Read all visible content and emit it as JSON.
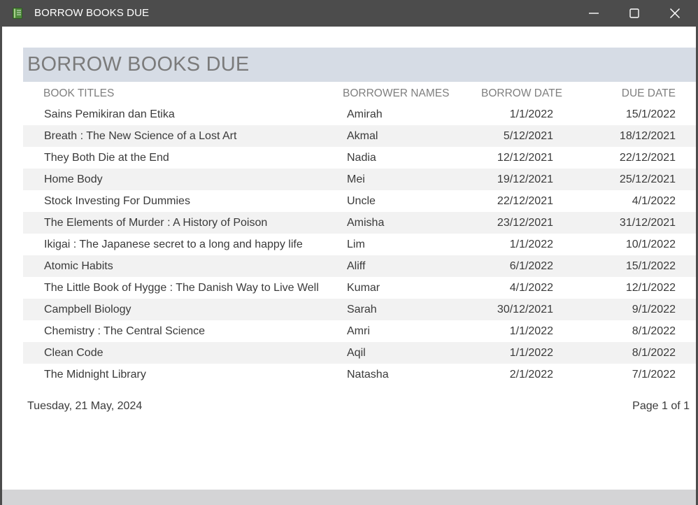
{
  "window": {
    "title": "BORROW BOOKS DUE",
    "app_icon": "book-icon",
    "controls": {
      "minimize_icon": "minimize-icon",
      "maximize_icon": "maximize-icon",
      "close_icon": "close-icon"
    }
  },
  "report": {
    "title": "BORROW BOOKS DUE",
    "header_color": "#d6dce5",
    "alt_row_color": "#f2f2f2",
    "columns": {
      "title": "BOOK TITLES",
      "borrower": "BORROWER NAMES",
      "borrow_date": "BORROW DATE",
      "due_date": "DUE DATE"
    },
    "rows": [
      {
        "title": "Sains Pemikiran dan Etika",
        "borrower": "Amirah",
        "borrow_date": "1/1/2022",
        "due_date": "15/1/2022"
      },
      {
        "title": "Breath : The New Science of a Lost Art",
        "borrower": "Akmal",
        "borrow_date": "5/12/2021",
        "due_date": "18/12/2021"
      },
      {
        "title": "They Both Die at the End",
        "borrower": "Nadia",
        "borrow_date": "12/12/2021",
        "due_date": "22/12/2021"
      },
      {
        "title": "Home Body",
        "borrower": "Mei",
        "borrow_date": "19/12/2021",
        "due_date": "25/12/2021"
      },
      {
        "title": "Stock Investing For Dummies",
        "borrower": "Uncle",
        "borrow_date": "22/12/2021",
        "due_date": "4/1/2022"
      },
      {
        "title": "The Elements of Murder : A History of Poison",
        "borrower": "Amisha",
        "borrow_date": "23/12/2021",
        "due_date": "31/12/2021"
      },
      {
        "title": "Ikigai : The Japanese secret to a long and happy life",
        "borrower": "Lim",
        "borrow_date": "1/1/2022",
        "due_date": "10/1/2022"
      },
      {
        "title": "Atomic Habits",
        "borrower": "Aliff",
        "borrow_date": "6/1/2022",
        "due_date": "15/1/2022"
      },
      {
        "title": "The Little Book of Hygge : The Danish Way to Live Well",
        "borrower": "Kumar",
        "borrow_date": "4/1/2022",
        "due_date": "12/1/2022"
      },
      {
        "title": "Campbell Biology",
        "borrower": "Sarah",
        "borrow_date": "30/12/2021",
        "due_date": "9/1/2022"
      },
      {
        "title": "Chemistry : The Central Science",
        "borrower": "Amri",
        "borrow_date": "1/1/2022",
        "due_date": "8/1/2022"
      },
      {
        "title": "Clean Code",
        "borrower": "Aqil",
        "borrow_date": "1/1/2022",
        "due_date": "8/1/2022"
      },
      {
        "title": "The Midnight Library",
        "borrower": "Natasha",
        "borrow_date": "2/1/2022",
        "due_date": "7/1/2022"
      }
    ],
    "footer": {
      "date": "Tuesday, 21 May, 2024",
      "page": "Page 1 of 1"
    }
  }
}
